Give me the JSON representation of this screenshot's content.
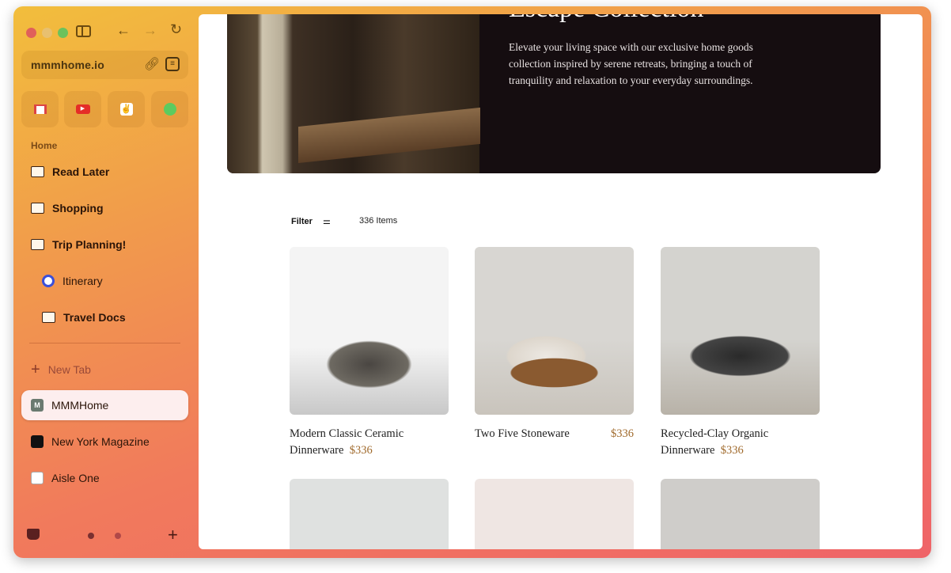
{
  "browser": {
    "url": "mmmhome.io",
    "favorites": [
      {
        "name": "Gmail",
        "icon": "gmail-icon"
      },
      {
        "name": "YouTube",
        "icon": "youtube-icon"
      },
      {
        "name": "Peace",
        "icon": "peace-hand-icon"
      },
      {
        "name": "Spotify",
        "icon": "spotify-icon"
      }
    ],
    "section": "Home",
    "folders": [
      {
        "label": "Read Later"
      },
      {
        "label": "Shopping"
      },
      {
        "label": "Trip Planning!"
      },
      {
        "label": "Itinerary"
      },
      {
        "label": "Travel Docs"
      }
    ],
    "new_tab": "New Tab",
    "tabs": [
      {
        "label": "MMMHome",
        "active": true
      },
      {
        "label": "New York Magazine"
      },
      {
        "label": "Aisle One"
      }
    ]
  },
  "hero": {
    "title": "Escape Collection",
    "text": "Elevate your living space with our exclusive home goods collection inspired by serene retreats, bringing a touch of tranquility and relaxation to your everyday surroundings."
  },
  "listing": {
    "filter": "Filter",
    "count": "336 Items",
    "products": [
      {
        "name": "Modern Classic Ceramic Dinnerware",
        "price": "$336"
      },
      {
        "name": "Two Five Stoneware",
        "price": "$336"
      },
      {
        "name": "Recycled-Clay Organic Dinnerware",
        "price": "$336"
      }
    ]
  }
}
